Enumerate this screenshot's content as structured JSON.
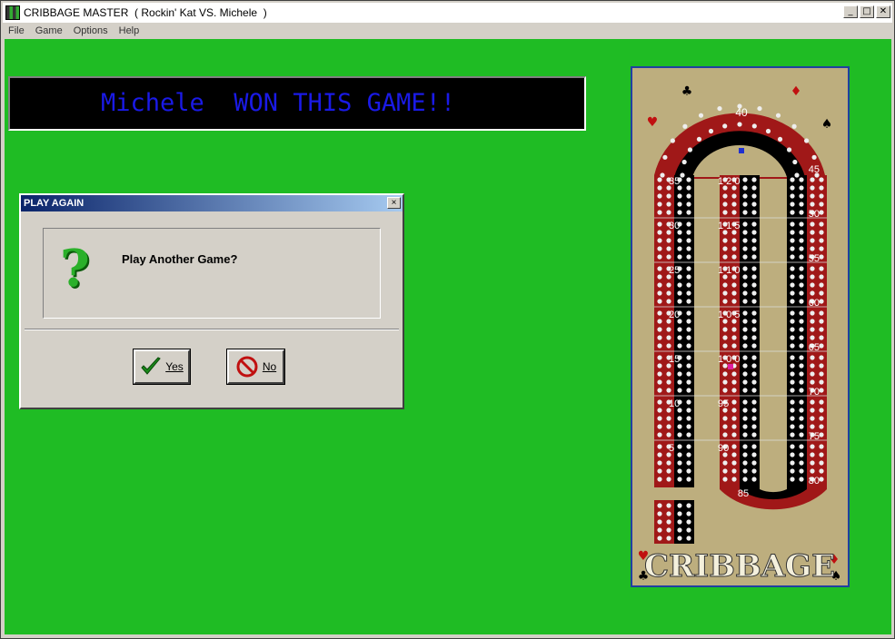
{
  "window": {
    "title": "CRIBBAGE MASTER  ( Rockin' Kat VS. Michele  )",
    "minimize": "_",
    "maximize": "□",
    "close": "✕"
  },
  "menu": [
    {
      "label": "File"
    },
    {
      "label": "Game"
    },
    {
      "label": "Options"
    },
    {
      "label": "Help"
    }
  ],
  "banner": {
    "text": "Michele  WON THIS GAME!!"
  },
  "dialog": {
    "title": "PLAY AGAIN",
    "close": "×",
    "message": "Play Another Game?",
    "icon": "question-mark-icon",
    "yes_label": "Yes",
    "no_label": "No"
  },
  "board": {
    "title": "CRIBBAGE",
    "colors": {
      "felt": "#1fbc24",
      "board": "#bdae7e",
      "track_red": "#a01818",
      "track_black": "#000000"
    },
    "labels": {
      "left": [
        "35",
        "30",
        "25",
        "20",
        "15",
        "10",
        "5"
      ],
      "right": [
        "45",
        "50",
        "55",
        "60",
        "65",
        "70",
        "75",
        "80"
      ],
      "top": "40",
      "bottom": "85",
      "center": [
        "1 2 0",
        "1 1 5",
        "1 1 0",
        "1 0 5",
        "1 0 0",
        "95",
        "90"
      ]
    }
  }
}
